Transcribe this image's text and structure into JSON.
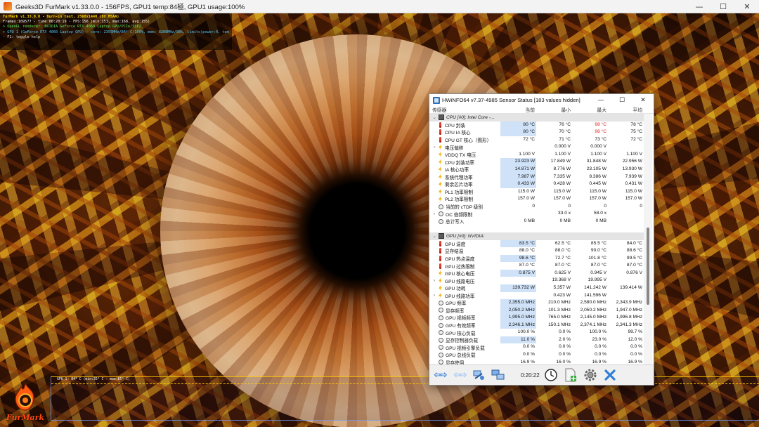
{
  "furmark": {
    "title": "Geeks3D FurMark v1.33.0.0 - 156FPS, GPU1 temp:84極, GPU1 usage:100%",
    "overlay": {
      "line1": "FurMark v1.33.0.0 - Burn-in test, 2560x1440 (8X MSAA)",
      "line2": "Frames:109577 - time:00:20:19 - FPS:156 (min:153, max:168, avg:155)",
      "line3": "> OpenGL renderer: NVIDIA GeForce RTX 4060 Laptop GPU/PCIe/SSE2",
      "line4": "> GPU 1 (GeForce RTX 4060 Laptop GPU) - core: 2355MHz/84° C/100%, mem: 8208MHz/98%, limits(power:0, temp:0, volt:0, OV:0)",
      "line5": "- F1: toggle help"
    },
    "graph_label": "GPU 1: 84° C (min:35° C - max:85° C)",
    "logo_text": "FurMark",
    "colors": {
      "overlay_title": "#ffd600",
      "overlay_gl": "#5fe35f",
      "overlay_gpu": "#4fc3f7",
      "logo": "#ff4a10"
    }
  },
  "window_controls": {
    "minimize": "—",
    "maximize": "☐",
    "close": "✕"
  },
  "hwinfo": {
    "title": "HWiNFO64 v7.37-4985 Sensor Status [183 values hidden]",
    "columns": {
      "sensor": "传感器",
      "current": "当前",
      "min": "最小",
      "max": "最大",
      "avg": "平均"
    },
    "rows": [
      {
        "type": "group",
        "exp": "⌄",
        "name": "CPU [#0]: Intel Core -...",
        "icon": "chip"
      },
      {
        "icon": "thermo",
        "name": "CPU 封装",
        "cur": "80 °C",
        "min": "76 °C",
        "max": "98 °C",
        "avg": "78 °C",
        "hl": true,
        "maxRed": true
      },
      {
        "icon": "thermo",
        "name": "CPU IA 核心",
        "cur": "80 °C",
        "min": "70 °C",
        "max": "98 °C",
        "avg": "75 °C",
        "hl": true,
        "maxRed": true
      },
      {
        "icon": "thermo",
        "name": "CPU GT 核心（图形）",
        "cur": "72 °C",
        "min": "71 °C",
        "max": "73 °C",
        "avg": "72 °C"
      },
      {
        "icon": "bolt",
        "exp": "›",
        "name": "电压偏移",
        "cur": "",
        "min": "0.000 V",
        "max": "0.000 V",
        "avg": ""
      },
      {
        "icon": "bolt",
        "name": "VDDQ TX 电压",
        "cur": "1.100 V",
        "min": "1.100 V",
        "max": "1.100 V",
        "avg": "1.100 V"
      },
      {
        "icon": "bolt",
        "name": "CPU 封装功率",
        "cur": "23.923 W",
        "min": "17.849 W",
        "max": "31.848 W",
        "avg": "22.956 W",
        "hl": true
      },
      {
        "icon": "bolt",
        "name": "IA 核心功率",
        "cur": "14.871 W",
        "min": "8.776 W",
        "max": "23.105 W",
        "avg": "13.930 W",
        "hl": true
      },
      {
        "icon": "bolt",
        "name": "系统代理功率",
        "cur": "7.987 W",
        "min": "7.335 W",
        "max": "8.386 W",
        "avg": "7.939 W",
        "hl": true
      },
      {
        "icon": "bolt",
        "name": "剩余芯片功率",
        "cur": "0.433 W",
        "min": "0.428 W",
        "max": "0.445 W",
        "avg": "0.431 W",
        "hl": true
      },
      {
        "icon": "bolt",
        "name": "PL1 功率限制",
        "cur": "115.0 W",
        "min": "115.0 W",
        "max": "115.0 W",
        "avg": "115.0 W"
      },
      {
        "icon": "bolt",
        "name": "PL2 功率限制",
        "cur": "157.0 W",
        "min": "157.0 W",
        "max": "157.0 W",
        "avg": "157.0 W"
      },
      {
        "icon": "clock",
        "name": "当前的 cTDP 级别",
        "cur": "0",
        "min": "0",
        "max": "0",
        "avg": "0"
      },
      {
        "icon": "clock",
        "exp": "›",
        "name": "OC 倍频限制",
        "cur": "",
        "min": "33.0 x",
        "max": "58.0 x",
        "avg": ""
      },
      {
        "icon": "clock",
        "name": "总计写入",
        "cur": "0 MB",
        "min": "0 MB",
        "max": "0 MB",
        "avg": ""
      },
      {
        "type": "blank"
      },
      {
        "type": "group",
        "exp": "⌄",
        "name": "GPU [#0]: NVIDIA:",
        "icon": "chip"
      },
      {
        "icon": "thermo",
        "name": "GPU 温度",
        "cur": "83.5 °C",
        "min": "62.5 °C",
        "max": "85.5 °C",
        "avg": "84.0 °C",
        "hl": true
      },
      {
        "icon": "thermo",
        "name": "显存结温",
        "cur": "88.0 °C",
        "min": "88.0 °C",
        "max": "90.0 °C",
        "avg": "88.6 °C"
      },
      {
        "icon": "thermo",
        "name": "GPU 热点温度",
        "cur": "98.6 °C",
        "min": "72.7 °C",
        "max": "101.8 °C",
        "avg": "99.5 °C",
        "hl": true
      },
      {
        "icon": "thermo",
        "name": "GPU 过热限制",
        "cur": "87.0 °C",
        "min": "87.0 °C",
        "max": "87.0 °C",
        "avg": "87.0 °C"
      },
      {
        "icon": "bolt",
        "name": "GPU 核心电压",
        "cur": "0.875 V",
        "min": "0.625 V",
        "max": "0.945 V",
        "avg": "0.876 V",
        "hl": true
      },
      {
        "icon": "bolt",
        "exp": "›",
        "name": "GPU 线路电压",
        "cur": "",
        "min": "19.368 V",
        "max": "19.995 V",
        "avg": ""
      },
      {
        "icon": "bolt",
        "name": "GPU 功耗",
        "cur": "139.732 W",
        "min": "5.357 W",
        "max": "141.242 W",
        "avg": "139.414 W",
        "hl": true
      },
      {
        "icon": "bolt",
        "exp": "›",
        "name": "GPU 线路功率",
        "cur": "",
        "min": "0.423 W",
        "max": "141.596 W",
        "avg": ""
      },
      {
        "icon": "clock",
        "name": "GPU 频率",
        "cur": "2,355.0 MHz",
        "min": "210.0 MHz",
        "max": "2,580.0 MHz",
        "avg": "2,343.9 MHz",
        "hl": true
      },
      {
        "icon": "clock",
        "name": "显存频率",
        "cur": "2,050.2 MHz",
        "min": "101.3 MHz",
        "max": "2,050.2 MHz",
        "avg": "1,947.0 MHz",
        "hl": true
      },
      {
        "icon": "clock",
        "name": "GPU 视频频率",
        "cur": "1,995.0 MHz",
        "min": "765.0 MHz",
        "max": "2,145.0 MHz",
        "avg": "1,996.8 MHz",
        "hl": true
      },
      {
        "icon": "clock",
        "name": "GPU 有效频率",
        "cur": "2,346.1 MHz",
        "min": "150.1 MHz",
        "max": "2,374.1 MHz",
        "avg": "2,341.3 MHz",
        "hl": true
      },
      {
        "icon": "clock",
        "name": "GPU 核心负载",
        "cur": "100.0 %",
        "min": "0.0 %",
        "max": "100.0 %",
        "avg": "99.7 %"
      },
      {
        "icon": "clock",
        "name": "显存控制器负载",
        "cur": "11.0 %",
        "min": "2.0 %",
        "max": "23.0 %",
        "avg": "12.0 %",
        "hl": true
      },
      {
        "icon": "clock",
        "name": "GPU 视频引擎负载",
        "cur": "0.0 %",
        "min": "0.0 %",
        "max": "0.0 %",
        "avg": "0.0 %"
      },
      {
        "icon": "clock",
        "name": "GPU 总线负载",
        "cur": "0.0 %",
        "min": "0.0 %",
        "max": "0.0 %",
        "avg": "0.0 %"
      },
      {
        "icon": "clock",
        "name": "显存使用",
        "cur": "16.9 %",
        "min": "16.0 %",
        "max": "16.9 %",
        "avg": "16.9 %"
      }
    ],
    "toolbar": {
      "timer": "0:20:22",
      "nav_prev": "⇦⇨",
      "nav_next": "⇦⇨"
    }
  }
}
